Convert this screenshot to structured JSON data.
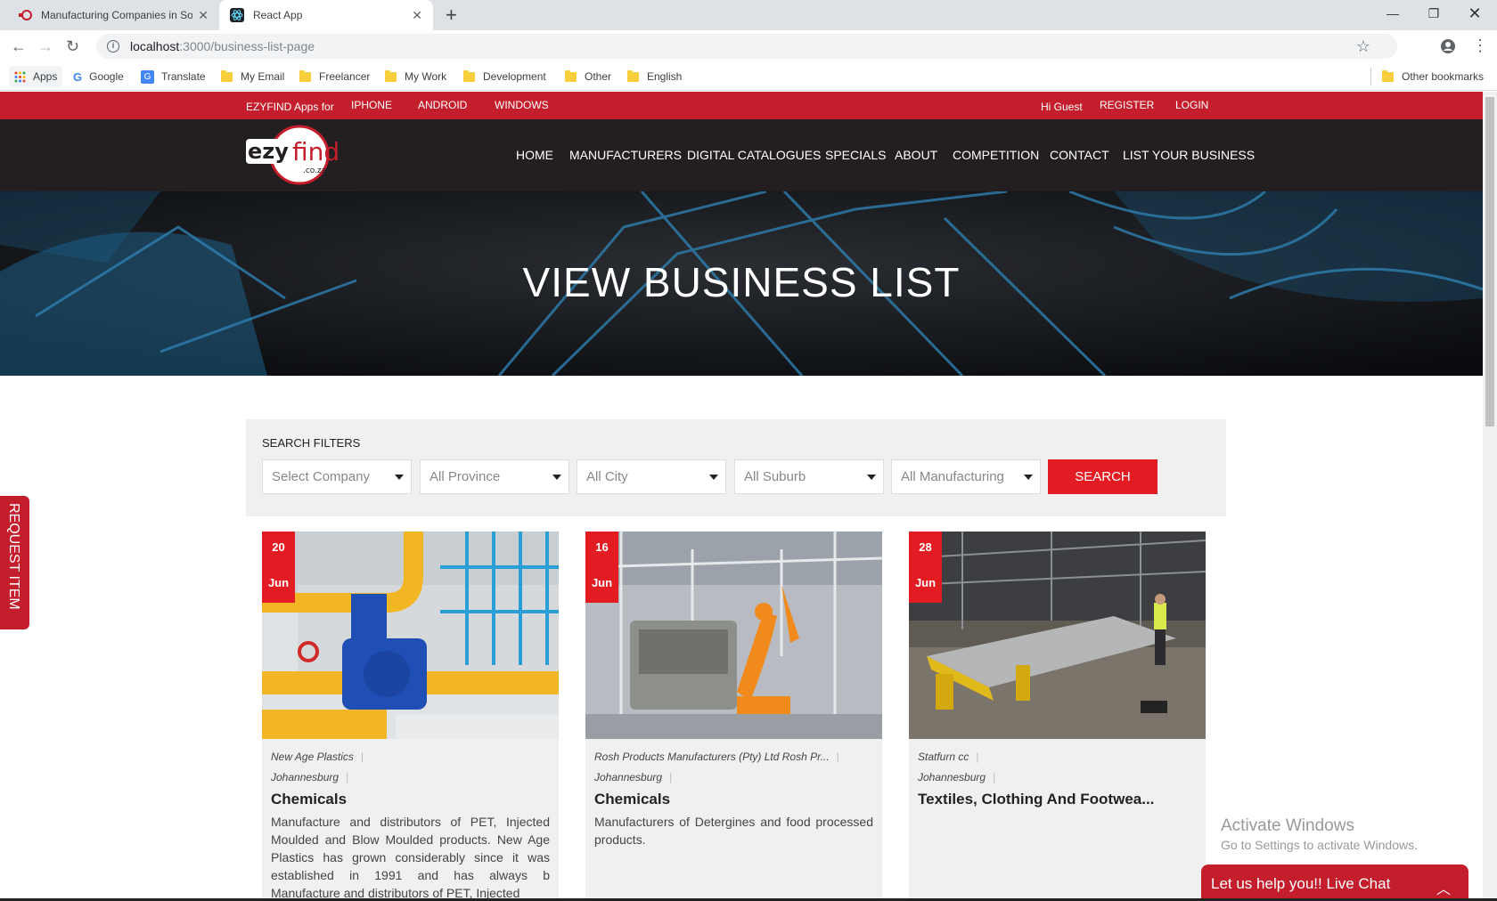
{
  "browser": {
    "tabs": [
      {
        "title": "Manufacturing Companies in South",
        "active": false
      },
      {
        "title": "React App",
        "active": true
      }
    ],
    "url_host": "localhost",
    "url_path": ":3000/business-list-page",
    "bookmarks": {
      "apps": "Apps",
      "items": [
        "Google",
        "Translate",
        "My Email",
        "Freelancer",
        "My Work",
        "Development",
        "Other",
        "English"
      ],
      "other": "Other bookmarks"
    }
  },
  "topbar": {
    "apps_for": "EZYFIND Apps for",
    "iphone": "IPHONE",
    "android": "ANDROID",
    "windows": "WINDOWS",
    "greeting": "Hi Guest",
    "register": "REGISTER",
    "login": "LOGIN"
  },
  "logo": {
    "text_left": "ezy",
    "text_right": "find",
    "domain": ".co.za"
  },
  "nav": [
    "HOME",
    "MANUFACTURERS",
    "DIGITAL CATALOGUES",
    "SPECIALS",
    "ABOUT",
    "COMPETITION",
    "CONTACT",
    "LIST YOUR BUSINESS"
  ],
  "hero": {
    "title": "VIEW BUSINESS LIST"
  },
  "filters": {
    "label": "SEARCH FILTERS",
    "company": "Select Company",
    "province": "All Province",
    "city": "All City",
    "suburb": "All Suburb",
    "manufacturing": "All Manufacturing",
    "search": "SEARCH"
  },
  "cards": [
    {
      "day": "20",
      "month": "Jun",
      "company": "New Age Plastics",
      "city": "Johannesburg",
      "category": "Chemicals",
      "description": "Manufacture and distributors of PET, Injected Moulded and Blow Moulded products. New Age Plastics has grown considerably since it was established in 1991 and has always b Manufacture and distributors of PET, Injected"
    },
    {
      "day": "16",
      "month": "Jun",
      "company": "Rosh Products Manufacturers (Pty) Ltd Rosh Pr...",
      "city": "Johannesburg",
      "category": "Chemicals",
      "description": "Manufacturers of Detergines and food processed products."
    },
    {
      "day": "28",
      "month": "Jun",
      "company": "Statfurn cc",
      "city": "Johannesburg",
      "category": "Textiles, Clothing And Footwea...",
      "description": ""
    }
  ],
  "request_tab": "REQUEST ITEM",
  "activate": {
    "line1": "Activate Windows",
    "line2": "Go to Settings to activate Windows."
  },
  "chat": {
    "label": "Let us help you!! Live Chat"
  },
  "colors": {
    "brand_red": "#c41e2c",
    "button_red": "#e31b23",
    "nav_dark": "#231f20"
  }
}
